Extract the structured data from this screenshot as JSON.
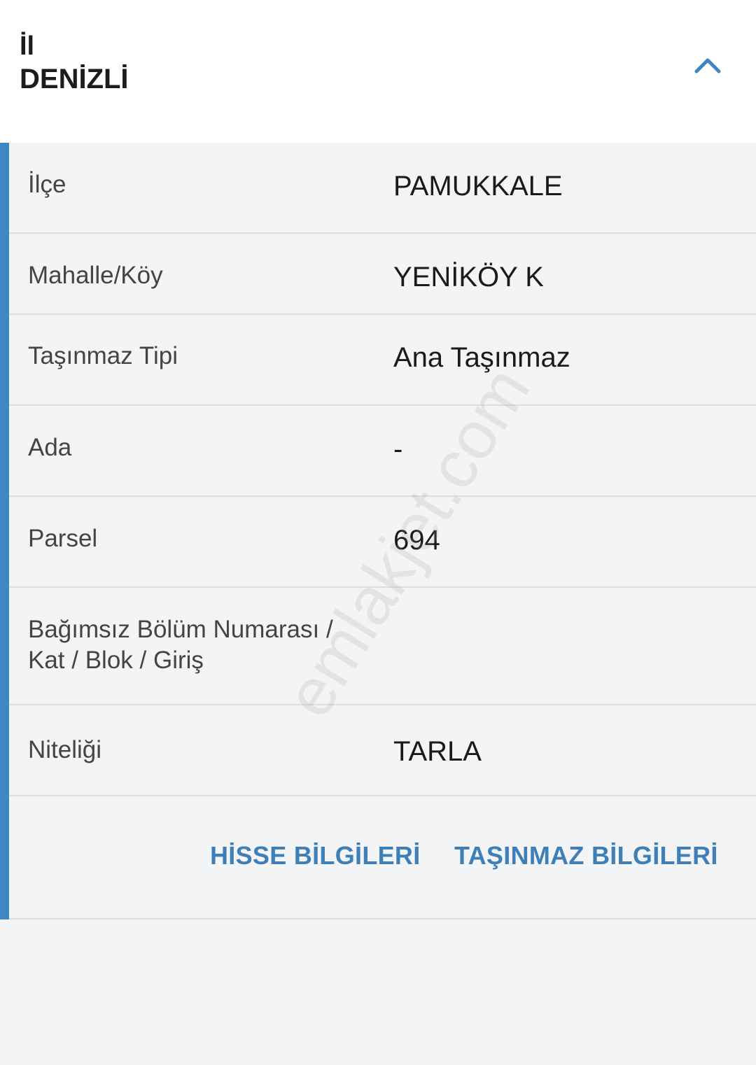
{
  "header": {
    "label": "İl",
    "value": "DENİZLİ",
    "collapse_icon": "chevron-up-icon",
    "collapse_icon_color": "#3f86c4"
  },
  "accent_color": "#3f86c4",
  "rows": [
    {
      "label": "İlçe",
      "value": "PAMUKKALE"
    },
    {
      "label": "Mahalle/Köy",
      "value": "YENİKÖY K"
    },
    {
      "label": "Taşınmaz Tipi",
      "value": "Ana Taşınmaz"
    },
    {
      "label": "Ada",
      "value": "-"
    },
    {
      "label": "Parsel",
      "value": "694"
    },
    {
      "label_line1": "Bağımsız Bölüm Numarası /",
      "label_line2": "Kat / Blok / Giriş",
      "value": ""
    },
    {
      "label": "Niteliği",
      "value": "TARLA"
    }
  ],
  "actions": {
    "hisse_label": "HİSSE BİLGİLERİ",
    "tasinmaz_label": "TAŞINMAZ BİLGİLERİ"
  },
  "watermark": "emlakjet.com"
}
